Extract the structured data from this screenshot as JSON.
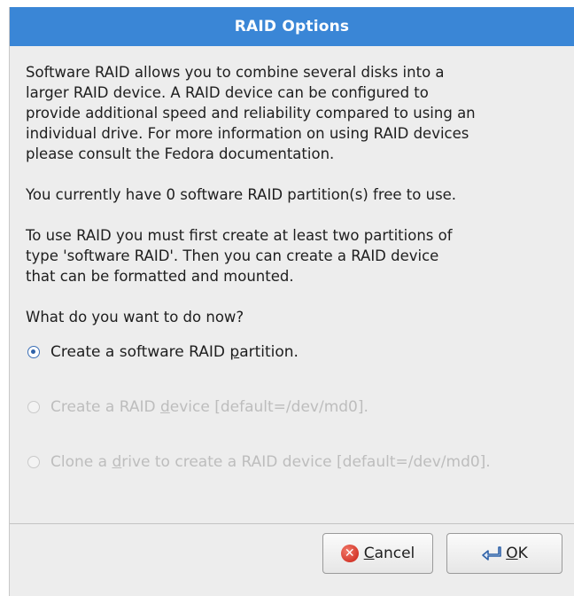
{
  "dialog": {
    "title": "RAID Options",
    "intro": "Software RAID allows you to combine several disks into a\nlarger RAID device.  A RAID device can be configured to\nprovide additional speed and reliability compared to using an\nindividual drive.  For more information on using RAID devices\nplease consult the Fedora documentation.",
    "status": "You currently have 0 software RAID partition(s) free to use.",
    "instructions": "To use RAID you must first create at least two partitions of\ntype 'software RAID'.  Then you can create a RAID device\nthat can be formatted and mounted.",
    "question": "What do you want to do now?",
    "options": [
      {
        "pre": "Create a software RAID ",
        "mnemonic": "p",
        "post": "artition.",
        "selected": true,
        "enabled": true
      },
      {
        "pre": "Create a RAID ",
        "mnemonic": "d",
        "post": "evice [default=/dev/md0].",
        "selected": false,
        "enabled": false
      },
      {
        "pre": "Clone a ",
        "mnemonic": "d",
        "post": "rive to create a RAID device [default=/dev/md0].",
        "selected": false,
        "enabled": false
      }
    ]
  },
  "buttons": {
    "cancel": {
      "mnemonic": "C",
      "rest": "ancel",
      "icon": "cancel-icon"
    },
    "ok": {
      "mnemonic": "O",
      "rest": "K",
      "icon": "ok-arrow-icon"
    }
  },
  "colors": {
    "titlebar": "#3a86d6",
    "dialog_bg": "#ededed",
    "disabled_text": "#bdbdbd"
  }
}
